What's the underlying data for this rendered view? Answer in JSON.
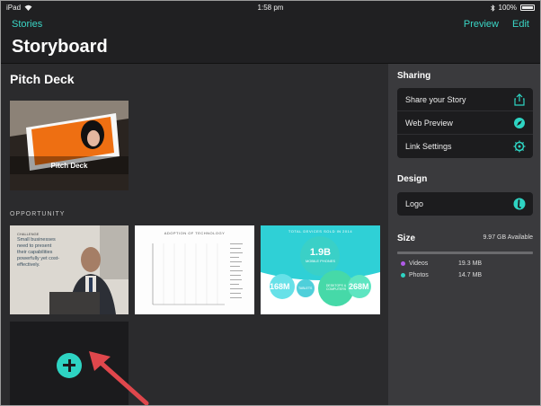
{
  "status_bar": {
    "device": "iPad",
    "time": "1:58 pm",
    "battery": "100%"
  },
  "nav": {
    "back_label": "Stories",
    "title": "Storyboard",
    "preview_label": "Preview",
    "edit_label": "Edit"
  },
  "main": {
    "section_title": "Pitch Deck",
    "cover_label": "Pitch Deck",
    "section_label": "OPPORTUNITY",
    "tiles": [
      {
        "heading": "CHALLENGE",
        "body": "Small businesses need to present their capabilities powerfully yet cost-effectively."
      },
      {
        "heading": "ADOPTION OF TECHNOLOGY"
      },
      {
        "heading": "TOTAL DEVICES SOLD IN 2014",
        "center_value": "1.9B",
        "center_label": "MOBILE PHONES",
        "left_value": "168M",
        "left_label": "TABLETS",
        "middle_label": "DESKTOPS & COMPUTERS",
        "right_value": "268M"
      }
    ]
  },
  "sidebar": {
    "sharing_title": "Sharing",
    "sharing_items": [
      {
        "label": "Share your Story",
        "icon": "share-icon"
      },
      {
        "label": "Web Preview",
        "icon": "compass-icon"
      },
      {
        "label": "Link Settings",
        "icon": "gear-icon"
      }
    ],
    "design_title": "Design",
    "design_items": [
      {
        "label": "Logo",
        "icon": "logo-icon"
      }
    ],
    "size_title": "Size",
    "size_available": "9.97 GB Available",
    "size_items": [
      {
        "label": "Videos",
        "value": "19.3 MB",
        "color": "#b05be8"
      },
      {
        "label": "Photos",
        "value": "14.7 MB",
        "color": "#2ed4c3"
      }
    ]
  },
  "colors": {
    "accent": "#3ad6c6",
    "arrow": "#e0474c"
  }
}
